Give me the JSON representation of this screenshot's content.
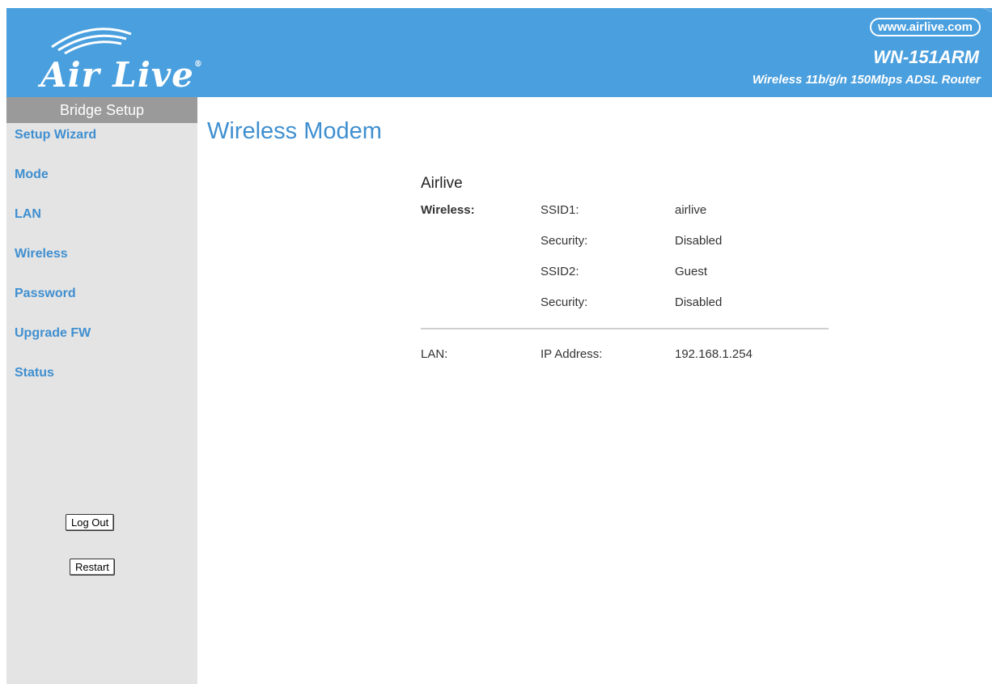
{
  "header": {
    "brand": "Air Live",
    "url": "www.airlive.com",
    "model": "WN-151ARM",
    "tagline": "Wireless 11b/g/n 150Mbps ADSL Router",
    "bg_color": "#4a9fde"
  },
  "sidebar": {
    "title": "Bridge Setup",
    "items": [
      {
        "label": "Setup Wizard"
      },
      {
        "label": "Mode"
      },
      {
        "label": "LAN"
      },
      {
        "label": "Wireless"
      },
      {
        "label": "Password"
      },
      {
        "label": "Upgrade FW"
      },
      {
        "label": "Status"
      }
    ],
    "logout_label": "Log Out",
    "restart_label": "Restart",
    "link_color": "#3f8fd0"
  },
  "main": {
    "title": "Wireless Modem",
    "panel_title": "Airlive",
    "wireless": {
      "label": "Wireless:",
      "rows": [
        {
          "key": "SSID1:",
          "value": "airlive"
        },
        {
          "key": "Security:",
          "value": "Disabled"
        },
        {
          "key": "SSID2:",
          "value": "Guest"
        },
        {
          "key": "Security:",
          "value": "Disabled"
        }
      ]
    },
    "lan": {
      "label": "LAN:",
      "key": "IP Address:",
      "value": "192.168.1.254"
    }
  }
}
